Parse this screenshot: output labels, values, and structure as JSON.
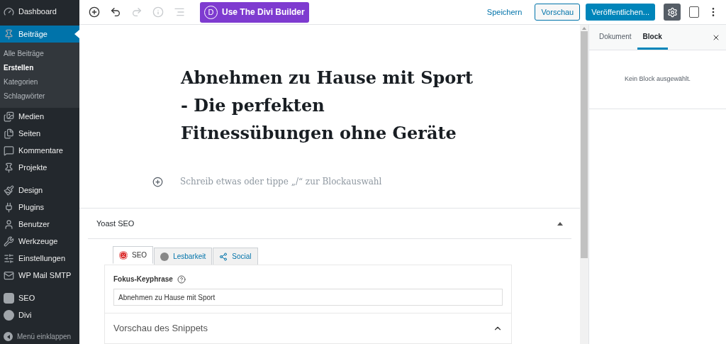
{
  "sidebar": {
    "groups": [
      [
        {
          "label": "Dashboard",
          "selected": false
        }
      ],
      [
        {
          "label": "Beiträge",
          "selected": true,
          "children": [
            {
              "label": "Alle Beiträge",
              "selected": false
            },
            {
              "label": "Erstellen",
              "selected": true
            },
            {
              "label": "Kategorien",
              "selected": false
            },
            {
              "label": "Schlagwörter",
              "selected": false
            }
          ]
        },
        {
          "label": "Medien",
          "selected": false
        },
        {
          "label": "Seiten",
          "selected": false
        },
        {
          "label": "Kommentare",
          "selected": false
        },
        {
          "label": "Projekte",
          "selected": false
        }
      ],
      [
        {
          "label": "Design",
          "selected": false
        },
        {
          "label": "Plugins",
          "selected": false
        },
        {
          "label": "Benutzer",
          "selected": false
        },
        {
          "label": "Werkzeuge",
          "selected": false
        },
        {
          "label": "Einstellungen",
          "selected": false
        },
        {
          "label": "WP Mail SMTP",
          "selected": false
        }
      ],
      [
        {
          "label": "SEO",
          "selected": false
        },
        {
          "label": "Divi",
          "selected": false
        }
      ]
    ],
    "collapse": "Menü einklappen"
  },
  "toolbar": {
    "tools": [
      {
        "kind": "add",
        "disabled": false
      },
      {
        "kind": "undo",
        "disabled": false
      },
      {
        "kind": "redo",
        "disabled": true
      },
      {
        "kind": "info",
        "disabled": true
      },
      {
        "kind": "outline",
        "disabled": true
      }
    ],
    "divi_button": "Use The Divi Builder",
    "divi_letter": "D",
    "save": "Speichern",
    "preview": "Vorschau",
    "publish": "Veröffentlichen..."
  },
  "editor": {
    "title": "Abnehmen zu Hause mit Sport - Die perfekten Fitnessübungen ohne Geräte",
    "placeholder": "Schreib etwas oder tippe „/“ zur Blockauswahl"
  },
  "yoast": {
    "title": "Yoast SEO",
    "expanded": true,
    "tabs": [
      {
        "label": "SEO",
        "selected": true,
        "kind": "status",
        "color": "#dc3232"
      },
      {
        "label": "Lesbarkeit",
        "selected": false,
        "kind": "status",
        "color": "#888888"
      },
      {
        "label": "Social",
        "selected": false,
        "kind": "share"
      }
    ],
    "keyphrase_label": "Fokus-Keyphrase",
    "keyphrase_value": "Abnehmen zu Hause mit Sport",
    "snippet_title": "Vorschau des Snippets",
    "snippet_expanded": true
  },
  "settings_panel": {
    "tabs": [
      {
        "label": "Dokument",
        "selected": false
      },
      {
        "label": "Block",
        "selected": true
      }
    ],
    "empty_text": "Kein Block ausgewählt."
  }
}
